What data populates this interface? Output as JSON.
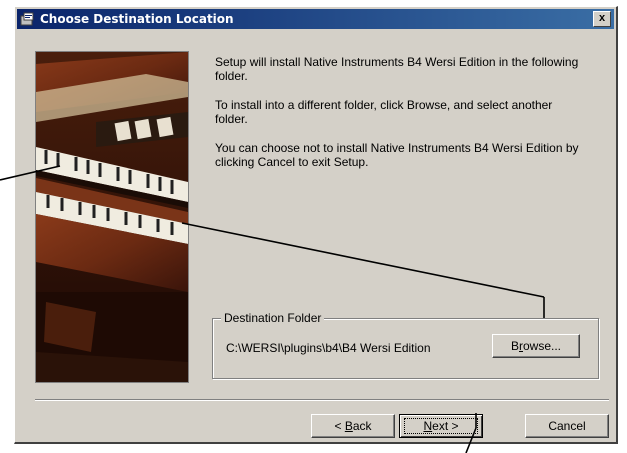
{
  "window": {
    "title": "Choose Destination Location",
    "close_label": "x"
  },
  "content": {
    "paragraphs": [
      "Setup will install Native Instruments B4 Wersi Edition in the following folder.",
      "To install into a different folder, click Browse, and select another folder.",
      "You can choose not to install Native Instruments B4 Wersi Edition by clicking Cancel to exit Setup."
    ]
  },
  "destination": {
    "group_label": "Destination Folder",
    "path": "C:\\WERSI\\plugins\\b4\\B4 Wersi Edition",
    "browse_prefix": "B",
    "browse_hotkey": "r",
    "browse_suffix": "owse..."
  },
  "buttons": {
    "back_prefix": "< ",
    "back_hotkey": "B",
    "back_suffix": "ack",
    "next_hotkey": "N",
    "next_suffix": "ext >",
    "cancel": "Cancel"
  },
  "colors": {
    "title_bar": "#0a246a",
    "dialog_face": "#d4d0c8",
    "wood": "#6b2a12"
  },
  "icons": [
    "setup-icon",
    "close-icon",
    "organ-image"
  ]
}
